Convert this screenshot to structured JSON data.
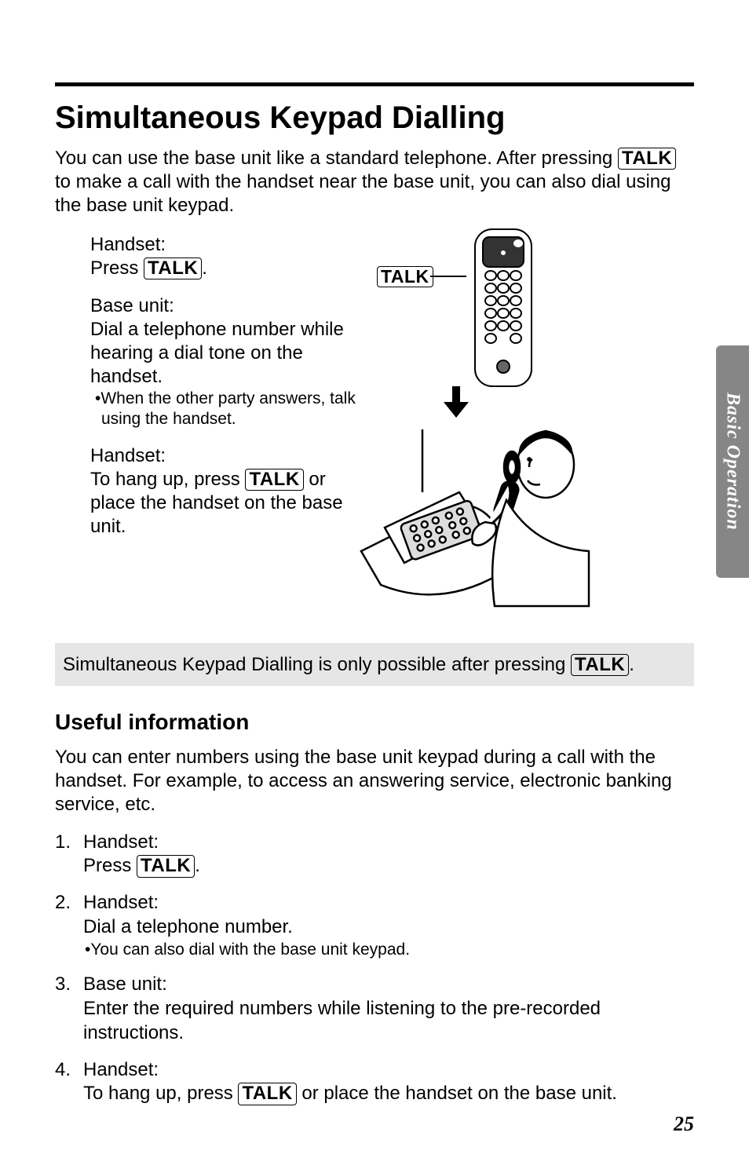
{
  "sidebar": {
    "label": "Basic Operation"
  },
  "title": "Simultaneous Keypad Dialling",
  "intro": {
    "p1a": "You can use the base unit like a standard telephone. After pressing ",
    "key1": "TALK",
    "p1b": " to make a call with the handset near the base unit, you can also dial using the base unit keypad."
  },
  "steps": {
    "s1": {
      "l1": "Handset:",
      "l2a": "Press ",
      "key": "TALK",
      "l2b": "."
    },
    "s2": {
      "l1": "Base unit:",
      "l2": "Dial a telephone number while hearing a dial tone on the handset.",
      "note": "•When the other party answers, talk using the handset."
    },
    "s3": {
      "l1": "Handset:",
      "l2a": "To hang up, press ",
      "key": "TALK",
      "l2b": " or place the handset on the base unit."
    }
  },
  "diagram": {
    "talklabel": "TALK"
  },
  "callout": {
    "a": "Simultaneous Keypad Dialling is only possible after pressing ",
    "key": "TALK",
    "b": "."
  },
  "useful": {
    "heading": "Useful information",
    "intro": "You can enter numbers using the base unit keypad during a call with the handset. For example, to access an answering service, electronic banking service, etc.",
    "items": {
      "n1": {
        "num": "1.",
        "l1": "Handset:",
        "l2a": "Press ",
        "key": "TALK",
        "l2b": "."
      },
      "n2": {
        "num": "2.",
        "l1": "Handset:",
        "l2": "Dial a telephone number.",
        "note": "•You can also dial with the base unit keypad."
      },
      "n3": {
        "num": "3.",
        "l1": "Base unit:",
        "l2": "Enter the required numbers while listening to the pre-recorded instructions."
      },
      "n4": {
        "num": "4.",
        "l1": "Handset:",
        "l2a": "To hang up, press ",
        "key": "TALK",
        "l2b": " or place the handset on the base unit."
      }
    }
  },
  "pagenum": "25"
}
